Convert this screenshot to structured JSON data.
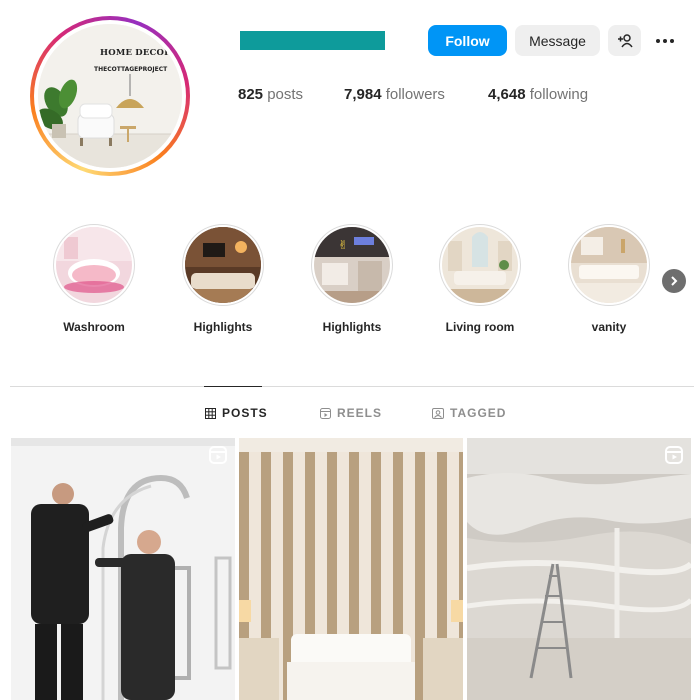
{
  "profile": {
    "avatar_text_line1": "HOME DECOR",
    "avatar_text_line2": "THECOTTAGEPROJECT",
    "username_color": "#0e9b9b"
  },
  "actions": {
    "follow_label": "Follow",
    "message_label": "Message",
    "add_user_icon": "add-person-icon",
    "more_icon": "more-options-icon"
  },
  "stats": {
    "posts_count": "825",
    "posts_label": "posts",
    "followers_count": "7,984",
    "followers_label": "followers",
    "following_count": "4,648",
    "following_label": "following"
  },
  "highlights": [
    {
      "label": "Washroom"
    },
    {
      "label": "Highlights"
    },
    {
      "label": "Highlights"
    },
    {
      "label": "Living room"
    },
    {
      "label": "vanity"
    }
  ],
  "tabs": [
    {
      "label": "POSTS",
      "active": true
    },
    {
      "label": "REELS",
      "active": false
    },
    {
      "label": "TAGGED",
      "active": false
    }
  ],
  "colors": {
    "accent": "#0095f6",
    "text": "#262626",
    "muted": "#737373"
  }
}
